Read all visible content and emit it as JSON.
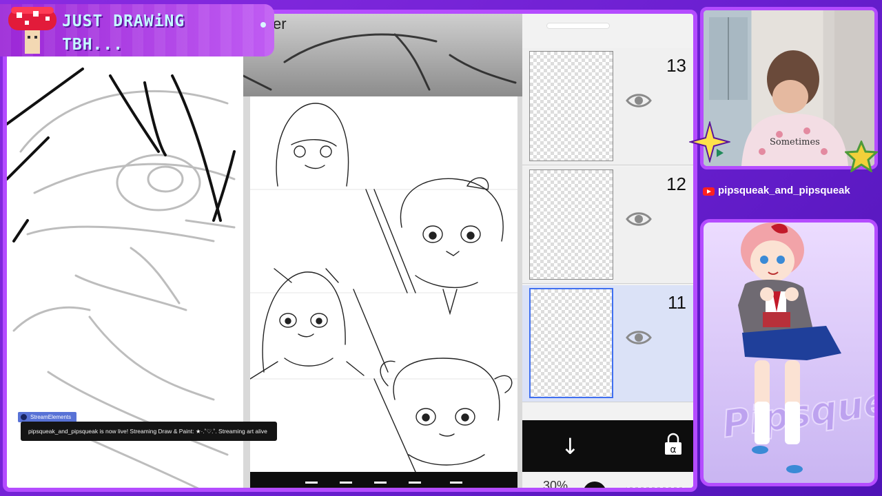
{
  "overlay": {
    "title_line1": "JUST DRAWiNG",
    "title_line2": "TBH...",
    "channel_name": "pipsqueak_and_pipsqueak",
    "brand_color": "#b44cff"
  },
  "app": {
    "layer_header": "yer",
    "layers": [
      {
        "number": "13",
        "selected": false
      },
      {
        "number": "12",
        "selected": false
      },
      {
        "number": "11",
        "selected": true
      }
    ],
    "opacity_label": "30%"
  },
  "stream_elements": {
    "badge": "StreamElements",
    "message": "pipsqueak_and_pipsqueak is now live! Streaming Draw & Paint: ★·.˚♡.˚. Streaming art alive"
  },
  "character_panel": {
    "watermark": "Pipsqueak"
  },
  "icons": [
    "mushroom-icon",
    "eye-icon",
    "arrow-down-icon",
    "alpha-lock-icon",
    "youtube-icon",
    "star-icon"
  ]
}
